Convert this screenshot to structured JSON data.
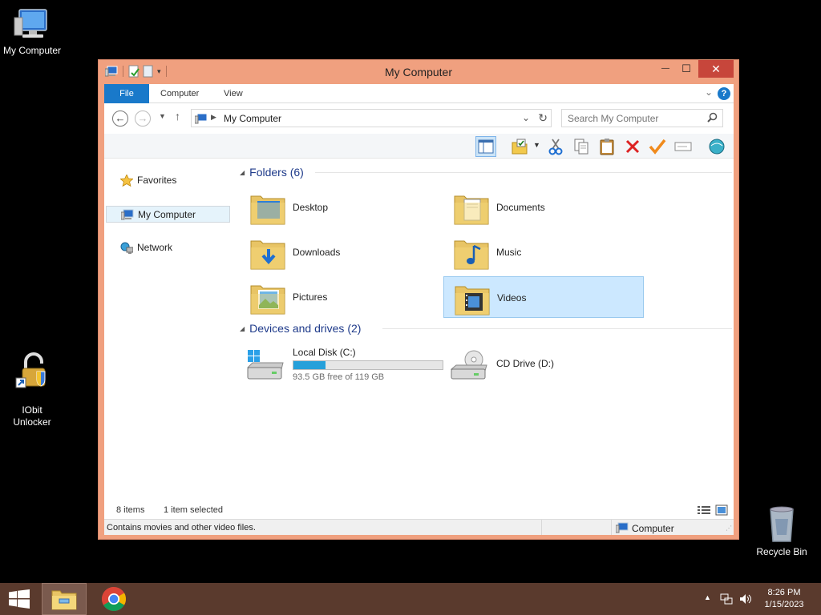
{
  "desktop": {
    "icons": [
      {
        "label": "My Computer"
      },
      {
        "label": "IObit\nUnlocker"
      },
      {
        "label": "Recycle Bin"
      }
    ]
  },
  "window": {
    "title": "My Computer",
    "controls": {
      "minimize": "—",
      "maximize": "☐",
      "close": "✕"
    }
  },
  "ribbon": {
    "tabs": [
      "File",
      "Computer",
      "View"
    ],
    "help": "?"
  },
  "address": {
    "path": "My Computer",
    "search_placeholder": "Search My Computer"
  },
  "nav_pane": {
    "items": [
      "Favorites",
      "My Computer",
      "Network"
    ],
    "selected": "My Computer"
  },
  "content": {
    "groups": [
      {
        "title": "Folders (6)",
        "items": [
          "Desktop",
          "Documents",
          "Downloads",
          "Music",
          "Pictures",
          "Videos"
        ],
        "selected": "Videos"
      },
      {
        "title": "Devices and drives (2)",
        "drives": [
          {
            "label": "Local Disk (C:)",
            "free_text": "93.5 GB free of 119 GB",
            "used_fraction": 0.214
          },
          {
            "label": "CD Drive (D:)"
          }
        ]
      }
    ]
  },
  "status": {
    "count": "8 items",
    "selection": "1 item selected",
    "description": "Contains movies and other video files.",
    "location": "Computer"
  },
  "taskbar": {
    "time": "8:26 PM",
    "date": "1/15/2023"
  },
  "colors": {
    "window_frame": "#f0a07f",
    "accent": "#1979ca",
    "taskbar": "#5a3a2d",
    "selection": "#cce8ff"
  }
}
